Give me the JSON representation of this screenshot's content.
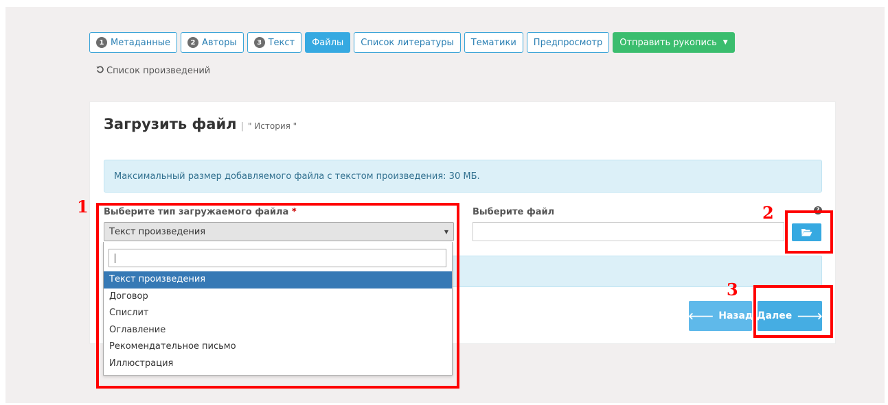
{
  "tabs": [
    {
      "num": "1",
      "label": "Метаданные",
      "state": "default"
    },
    {
      "num": "2",
      "label": "Авторы",
      "state": "default"
    },
    {
      "num": "3",
      "label": "Текст",
      "state": "default"
    },
    {
      "num": "",
      "label": "Файлы",
      "state": "active"
    },
    {
      "num": "",
      "label": "Список литературы",
      "state": "default"
    },
    {
      "num": "",
      "label": "Тематики",
      "state": "default"
    },
    {
      "num": "",
      "label": "Предпросмотр",
      "state": "default"
    },
    {
      "num": "",
      "label": "Отправить рукопись",
      "state": "submit"
    }
  ],
  "back_link": {
    "icon": "undo-icon",
    "label": "Список произведений"
  },
  "card": {
    "title": "Загрузить файл",
    "separator": "|",
    "subtitle": "\" История \"",
    "alert_text": "Максимальный размер добавляемого файла с текстом произведения: 30 МБ.",
    "file_type_label": "Выберите тип загружаемого файла",
    "required_mark": "*",
    "file_label": "Выберите файл",
    "help_icon": "?",
    "selected_type": "Текст произведения",
    "back_button": "Назад",
    "next_button": "Далее"
  },
  "dropdown": {
    "search_value": "",
    "options": [
      "Текст произведения",
      "Договор",
      "Спислит",
      "Оглавление",
      "Рекомендательное письмо",
      "Иллюстрация"
    ],
    "selected_index": 0
  },
  "annotations": [
    "1",
    "2",
    "3"
  ],
  "colors": {
    "accent": "#36a9e1",
    "submit": "#3bbd6e",
    "annotation": "#ff0000",
    "selected_option": "#3679b5",
    "alert_bg": "#dcf0f8"
  }
}
